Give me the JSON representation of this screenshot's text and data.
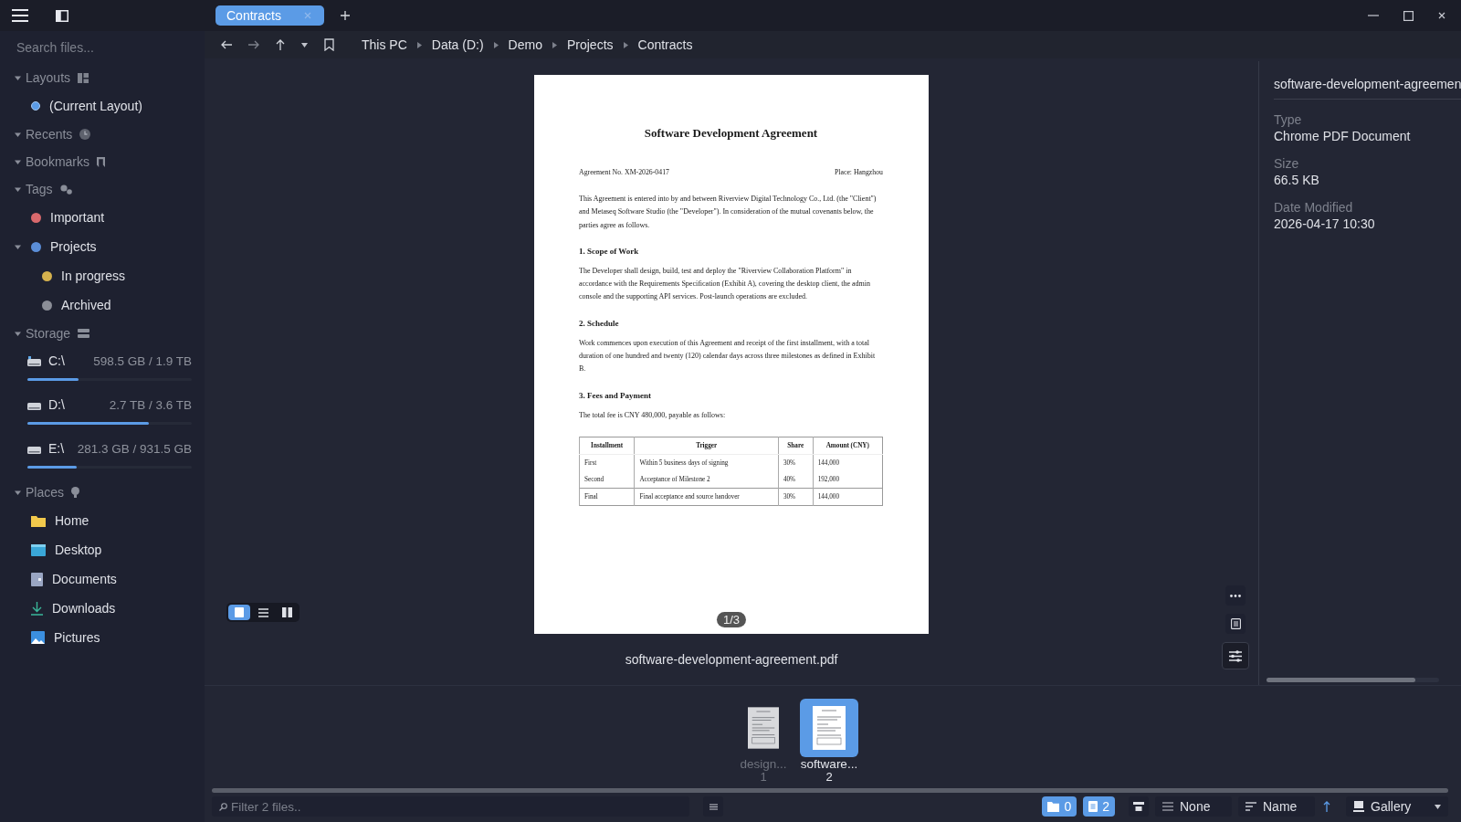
{
  "tabs": [
    {
      "label": "Contracts",
      "selected": true
    }
  ],
  "sidebar": {
    "search_placeholder": "Search files...",
    "sections": [
      {
        "kind": "layouts",
        "title": "Layouts",
        "expanded": true,
        "items": [
          {
            "label": "(Current Layout)",
            "selected": true
          }
        ]
      },
      {
        "kind": "recents",
        "title": "Recents",
        "expanded": true
      },
      {
        "kind": "bookmarks",
        "title": "Bookmarks",
        "expanded": true
      },
      {
        "kind": "tags",
        "title": "Tags",
        "expanded": true,
        "items": [
          {
            "label": "Important",
            "color": "#d9696c"
          },
          {
            "label": "Projects",
            "color": "#5b8ed8",
            "expanded": true,
            "children": [
              {
                "label": "In progress",
                "color": "#d6b24e"
              },
              {
                "label": "Archived",
                "color": "#8b8e97"
              }
            ]
          }
        ]
      },
      {
        "kind": "storage",
        "title": "Storage",
        "expanded": true,
        "items": [
          {
            "label": "C:\\",
            "usage": "598.5 GB / 1.9 TB",
            "level": 0.31
          },
          {
            "label": "D:\\",
            "usage": "2.7 TB / 3.6 TB",
            "level": 0.74
          },
          {
            "label": "E:\\",
            "usage": "281.3 GB / 931.5 GB",
            "level": 0.3
          }
        ]
      },
      {
        "kind": "places",
        "title": "Places",
        "expanded": true,
        "items": [
          {
            "kind": "folder",
            "label": "Home"
          },
          {
            "kind": "desktop",
            "label": "Desktop"
          },
          {
            "kind": "documents",
            "label": "Documents"
          },
          {
            "kind": "downloads",
            "label": "Downloads"
          },
          {
            "kind": "pictures",
            "label": "Pictures"
          }
        ]
      }
    ]
  },
  "breadcrumbs": [
    "This PC",
    "Data (D:)",
    "Demo",
    "Projects",
    "Contracts"
  ],
  "document": {
    "title": "Software Development Agreement",
    "meta_left": "Agreement No. XM-2026-0417",
    "meta_right": "Place: Hangzhou",
    "blocks": [
      {
        "kind": "paragraph",
        "text": "This Agreement is entered into by and between Riverview Digital Technology Co., Ltd. (the \"Client\") and Metaseq Software Studio (the \"Developer\"). In consideration of the mutual covenants below, the parties agree as follows."
      },
      {
        "kind": "heading",
        "text": "1. Scope of Work"
      },
      {
        "kind": "paragraph",
        "text": "The Developer shall design, build, test and deploy the \"Riverview Collaboration Platform\" in accordance with the Requirements Specification (Exhibit A), covering the desktop client, the admin console and the supporting API services. Post-launch operations are excluded."
      },
      {
        "kind": "heading",
        "text": "2. Schedule"
      },
      {
        "kind": "paragraph",
        "text": "Work commences upon execution of this Agreement and receipt of the first installment, with a total duration of one hundred and twenty (120) calendar days across three milestones as defined in Exhibit B."
      },
      {
        "kind": "heading",
        "text": "3. Fees and Payment"
      },
      {
        "kind": "paragraph",
        "text": "The total fee is CNY 480,000, payable as follows:"
      },
      {
        "kind": "table",
        "columns": [
          "Installment",
          "Trigger",
          "Share",
          "Amount (CNY)"
        ],
        "rows": [
          [
            "First",
            "Within 5 business days of signing",
            "30%",
            "144,000"
          ],
          [
            "Second",
            "Acceptance of Milestone 2",
            "40%",
            "192,000"
          ],
          [
            "Final",
            "Final acceptance and source handover",
            "30%",
            "144,000"
          ]
        ]
      }
    ],
    "page_indicator": "1/3"
  },
  "file_name": "software-development-agreement.pdf",
  "view_modes": [
    {
      "kind": "single",
      "selected": true
    },
    {
      "kind": "list",
      "selected": false
    },
    {
      "kind": "columns",
      "selected": false
    }
  ],
  "info": {
    "name": "software-development-agreemen",
    "fields": [
      {
        "label": "Type",
        "value": "Chrome PDF Document"
      },
      {
        "label": "Size",
        "value": "66.5 KB"
      },
      {
        "label": "Date Modified",
        "value": "2026-04-17 10:30"
      }
    ]
  },
  "thumbnails": [
    {
      "name": "design...",
      "index": "1",
      "selected": false
    },
    {
      "name": "software...",
      "index": "2",
      "selected": true
    }
  ],
  "status_bar": {
    "filter_placeholder": "Filter 2 files..",
    "folder_count": {
      "text": "0",
      "selected": true
    },
    "file_count": {
      "text": "2",
      "selected": true
    },
    "group": "None",
    "sort": "Name",
    "view": "Gallery"
  }
}
